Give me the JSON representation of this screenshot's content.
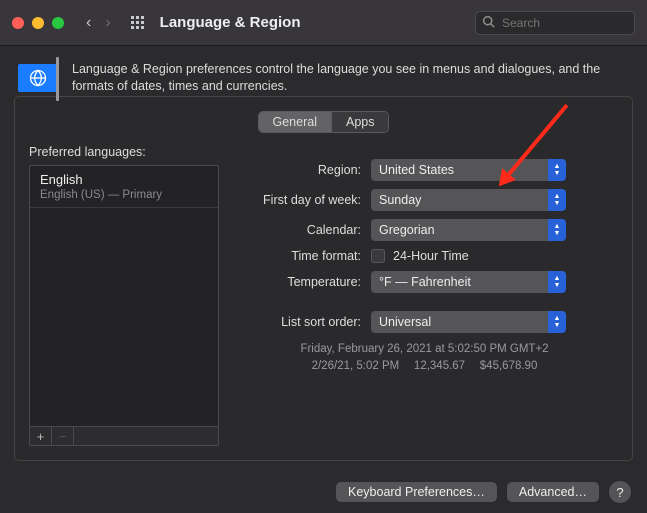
{
  "titlebar": {
    "title": "Language & Region",
    "search_placeholder": "Search"
  },
  "intro": {
    "text": "Language & Region preferences control the language you see in menus and dialogues, and the formats of dates, times and currencies."
  },
  "tabs": {
    "general": "General",
    "apps": "Apps"
  },
  "form": {
    "preferred_label": "Preferred languages:",
    "lang_name": "English",
    "lang_sub": "English (US) — Primary",
    "region_label": "Region:",
    "region_value": "United States",
    "firstday_label": "First day of week:",
    "firstday_value": "Sunday",
    "calendar_label": "Calendar:",
    "calendar_value": "Gregorian",
    "timefmt_label": "Time format:",
    "timefmt_value": "24-Hour Time",
    "temperature_label": "Temperature:",
    "temperature_value": "°F — Fahrenheit",
    "listsort_label": "List sort order:",
    "listsort_value": "Universal",
    "add": "+",
    "remove": "−"
  },
  "preview": {
    "line1": "Friday, February 26, 2021 at 5:02:50 PM GMT+2",
    "line2": "2/26/21, 5:02 PM  12,345.67  $45,678.90"
  },
  "bottom": {
    "keyboard": "Keyboard Preferences…",
    "advanced": "Advanced…",
    "help": "?"
  }
}
